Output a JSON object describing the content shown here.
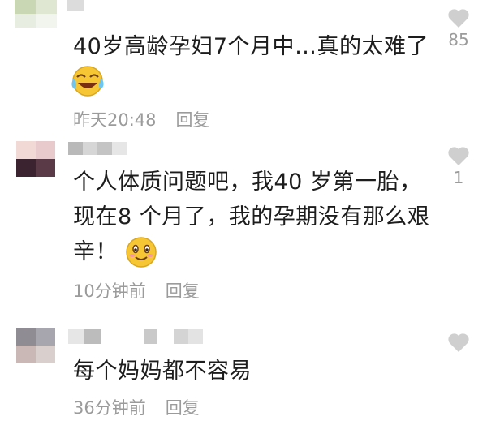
{
  "comments": [
    {
      "lines": [
        "40岁高龄孕妇7个月中…真的太难了"
      ],
      "emoji": "laughing-crying-emoji",
      "time": "昨天20:48",
      "reply": "回复",
      "likes": "85"
    },
    {
      "lines": [
        "个人体质问题吧，我40 岁第一胎，",
        "现在8 个月了，我的孕期没有那么艰",
        "辛！"
      ],
      "emoji": "smiling-emoji",
      "time": "10分钟前",
      "reply": "回复",
      "likes": "1"
    },
    {
      "lines": [
        "每个妈妈都不容易"
      ],
      "time": "36分钟前",
      "reply": "回复",
      "likes": ""
    }
  ],
  "colors": {
    "text": "#1d1d1d",
    "meta": "#9b9b9b",
    "heart": "#cfcfcf",
    "emoji_yellow": "#f7c634"
  },
  "icons": [
    "heart-icon",
    "avatar-placeholder"
  ]
}
